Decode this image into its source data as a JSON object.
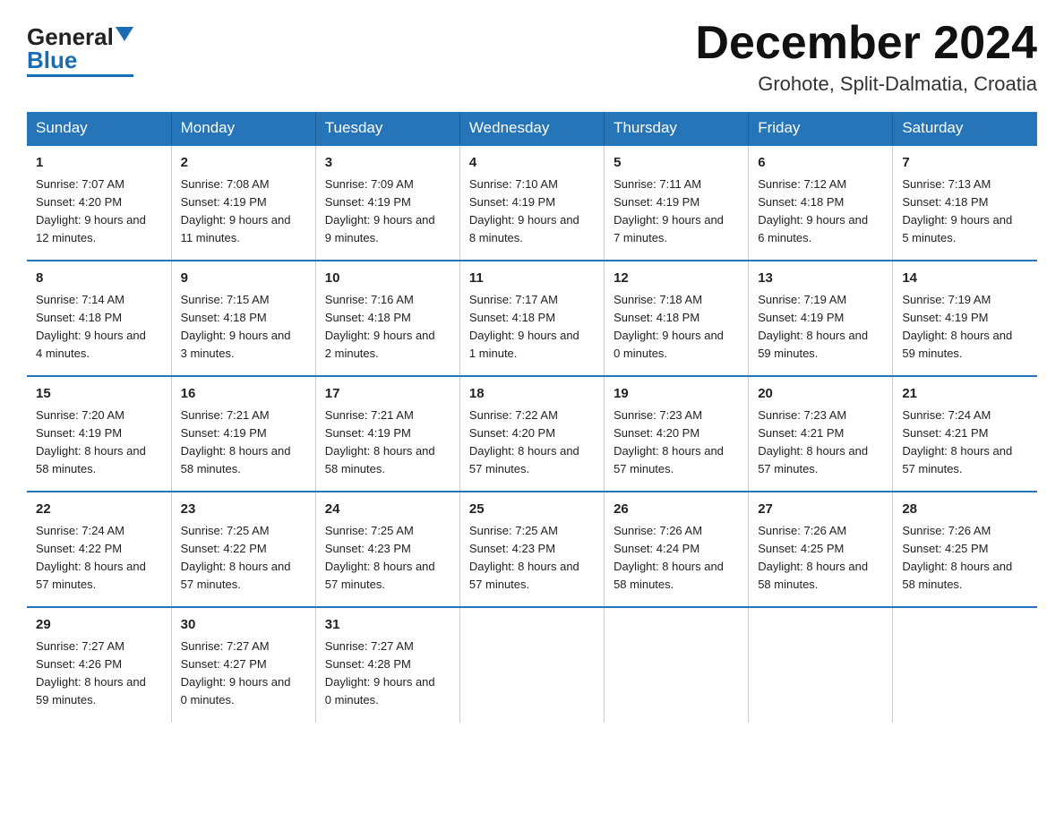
{
  "header": {
    "logo_general": "General",
    "logo_blue": "Blue",
    "month_title": "December 2024",
    "location": "Grohote, Split-Dalmatia, Croatia"
  },
  "weekdays": [
    "Sunday",
    "Monday",
    "Tuesday",
    "Wednesday",
    "Thursday",
    "Friday",
    "Saturday"
  ],
  "weeks": [
    [
      {
        "day": "1",
        "sunrise": "7:07 AM",
        "sunset": "4:20 PM",
        "daylight": "9 hours and 12 minutes."
      },
      {
        "day": "2",
        "sunrise": "7:08 AM",
        "sunset": "4:19 PM",
        "daylight": "9 hours and 11 minutes."
      },
      {
        "day": "3",
        "sunrise": "7:09 AM",
        "sunset": "4:19 PM",
        "daylight": "9 hours and 9 minutes."
      },
      {
        "day": "4",
        "sunrise": "7:10 AM",
        "sunset": "4:19 PM",
        "daylight": "9 hours and 8 minutes."
      },
      {
        "day": "5",
        "sunrise": "7:11 AM",
        "sunset": "4:19 PM",
        "daylight": "9 hours and 7 minutes."
      },
      {
        "day": "6",
        "sunrise": "7:12 AM",
        "sunset": "4:18 PM",
        "daylight": "9 hours and 6 minutes."
      },
      {
        "day": "7",
        "sunrise": "7:13 AM",
        "sunset": "4:18 PM",
        "daylight": "9 hours and 5 minutes."
      }
    ],
    [
      {
        "day": "8",
        "sunrise": "7:14 AM",
        "sunset": "4:18 PM",
        "daylight": "9 hours and 4 minutes."
      },
      {
        "day": "9",
        "sunrise": "7:15 AM",
        "sunset": "4:18 PM",
        "daylight": "9 hours and 3 minutes."
      },
      {
        "day": "10",
        "sunrise": "7:16 AM",
        "sunset": "4:18 PM",
        "daylight": "9 hours and 2 minutes."
      },
      {
        "day": "11",
        "sunrise": "7:17 AM",
        "sunset": "4:18 PM",
        "daylight": "9 hours and 1 minute."
      },
      {
        "day": "12",
        "sunrise": "7:18 AM",
        "sunset": "4:18 PM",
        "daylight": "9 hours and 0 minutes."
      },
      {
        "day": "13",
        "sunrise": "7:19 AM",
        "sunset": "4:19 PM",
        "daylight": "8 hours and 59 minutes."
      },
      {
        "day": "14",
        "sunrise": "7:19 AM",
        "sunset": "4:19 PM",
        "daylight": "8 hours and 59 minutes."
      }
    ],
    [
      {
        "day": "15",
        "sunrise": "7:20 AM",
        "sunset": "4:19 PM",
        "daylight": "8 hours and 58 minutes."
      },
      {
        "day": "16",
        "sunrise": "7:21 AM",
        "sunset": "4:19 PM",
        "daylight": "8 hours and 58 minutes."
      },
      {
        "day": "17",
        "sunrise": "7:21 AM",
        "sunset": "4:19 PM",
        "daylight": "8 hours and 58 minutes."
      },
      {
        "day": "18",
        "sunrise": "7:22 AM",
        "sunset": "4:20 PM",
        "daylight": "8 hours and 57 minutes."
      },
      {
        "day": "19",
        "sunrise": "7:23 AM",
        "sunset": "4:20 PM",
        "daylight": "8 hours and 57 minutes."
      },
      {
        "day": "20",
        "sunrise": "7:23 AM",
        "sunset": "4:21 PM",
        "daylight": "8 hours and 57 minutes."
      },
      {
        "day": "21",
        "sunrise": "7:24 AM",
        "sunset": "4:21 PM",
        "daylight": "8 hours and 57 minutes."
      }
    ],
    [
      {
        "day": "22",
        "sunrise": "7:24 AM",
        "sunset": "4:22 PM",
        "daylight": "8 hours and 57 minutes."
      },
      {
        "day": "23",
        "sunrise": "7:25 AM",
        "sunset": "4:22 PM",
        "daylight": "8 hours and 57 minutes."
      },
      {
        "day": "24",
        "sunrise": "7:25 AM",
        "sunset": "4:23 PM",
        "daylight": "8 hours and 57 minutes."
      },
      {
        "day": "25",
        "sunrise": "7:25 AM",
        "sunset": "4:23 PM",
        "daylight": "8 hours and 57 minutes."
      },
      {
        "day": "26",
        "sunrise": "7:26 AM",
        "sunset": "4:24 PM",
        "daylight": "8 hours and 58 minutes."
      },
      {
        "day": "27",
        "sunrise": "7:26 AM",
        "sunset": "4:25 PM",
        "daylight": "8 hours and 58 minutes."
      },
      {
        "day": "28",
        "sunrise": "7:26 AM",
        "sunset": "4:25 PM",
        "daylight": "8 hours and 58 minutes."
      }
    ],
    [
      {
        "day": "29",
        "sunrise": "7:27 AM",
        "sunset": "4:26 PM",
        "daylight": "8 hours and 59 minutes."
      },
      {
        "day": "30",
        "sunrise": "7:27 AM",
        "sunset": "4:27 PM",
        "daylight": "9 hours and 0 minutes."
      },
      {
        "day": "31",
        "sunrise": "7:27 AM",
        "sunset": "4:28 PM",
        "daylight": "9 hours and 0 minutes."
      },
      null,
      null,
      null,
      null
    ]
  ],
  "sunrise_label": "Sunrise:",
  "sunset_label": "Sunset:",
  "daylight_label": "Daylight:"
}
